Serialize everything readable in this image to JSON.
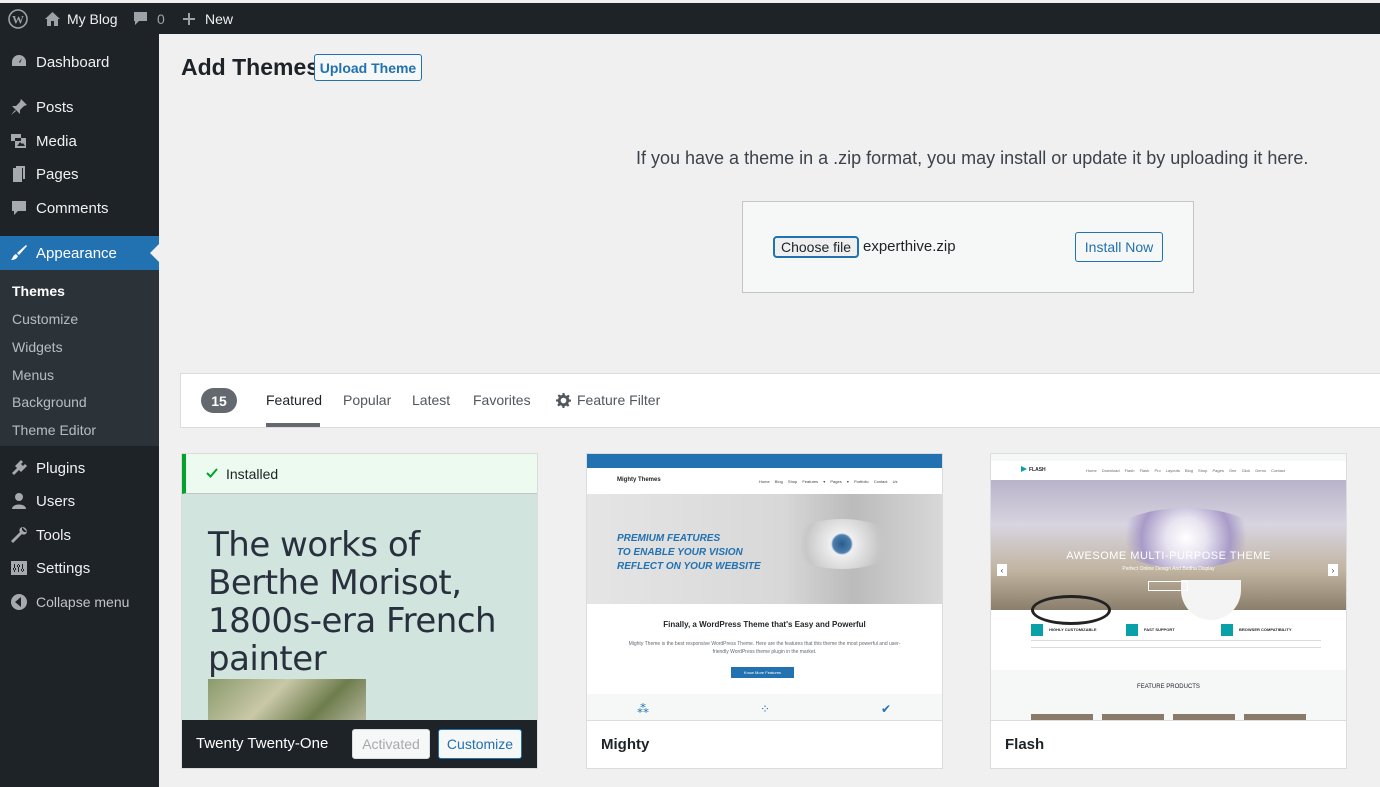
{
  "admin_bar": {
    "site_name": "My Blog",
    "comments_count": "0",
    "new_label": "New"
  },
  "sidebar": {
    "items": [
      {
        "label": "Dashboard",
        "icon": "dashboard-icon"
      },
      {
        "label": "Posts",
        "icon": "pin-icon"
      },
      {
        "label": "Media",
        "icon": "media-icon"
      },
      {
        "label": "Pages",
        "icon": "pages-icon"
      },
      {
        "label": "Comments",
        "icon": "comment-icon"
      },
      {
        "label": "Appearance",
        "icon": "brush-icon",
        "active": true
      },
      {
        "label": "Plugins",
        "icon": "plugin-icon"
      },
      {
        "label": "Users",
        "icon": "user-icon"
      },
      {
        "label": "Tools",
        "icon": "wrench-icon"
      },
      {
        "label": "Settings",
        "icon": "settings-icon"
      },
      {
        "label": "Collapse menu",
        "icon": "collapse-icon"
      }
    ],
    "submenu": [
      "Themes",
      "Customize",
      "Widgets",
      "Menus",
      "Background",
      "Theme Editor"
    ]
  },
  "header": {
    "title": "Add Themes",
    "upload_button": "Upload Theme"
  },
  "upload": {
    "description": "If you have a theme in a .zip format, you may install or update it by uploading it here.",
    "choose_file": "Choose file",
    "file_name": "experthive.zip",
    "install_button": "Install Now"
  },
  "filter": {
    "count": "15",
    "tabs": [
      "Featured",
      "Popular",
      "Latest",
      "Favorites"
    ],
    "feature_filter": "Feature Filter",
    "active_tab": "Featured"
  },
  "themes": [
    {
      "name": "Twenty Twenty-One",
      "installed_label": "Installed",
      "headline": "The works of Berthe Morisot, 1800s-era French painter",
      "activated_label": "Activated",
      "customize_label": "Customize"
    },
    {
      "name": "Mighty",
      "preview": {
        "logo": "Mighty Themes",
        "menu": "Home Blog Shop Features ▾ Pages ▾ Portfolio Contact Us",
        "hero": [
          "PREMIUM FEATURES",
          "TO ENABLE YOUR VISION",
          "REFLECT ON YOUR WEBSITE"
        ],
        "subtitle": "Finally, a WordPress Theme that's Easy and Powerful",
        "paragraph": "Mighty Theme is the best responsive WordPress Theme. Here are the features that this theme the most powerful and user-friendly WordPress theme plugin in the market.",
        "button": "Know More Features"
      }
    },
    {
      "name": "Flash",
      "preview": {
        "logo": "FLASH",
        "menu": "Home Download Flash Flash Pro Layouts Blog Shop Pages One Click Demo Contact",
        "hero_title": "AWESOME MULTI-PURPOSE THEME",
        "hero_sub": "Perfect Online Design And Bettha Display",
        "features": [
          "HIGHLY CUSTOMIZABLE",
          "FAST SUPPORT",
          "BROWSER COMPATIBILITY"
        ],
        "band_title": "FEATURE PRODUCTS"
      }
    }
  ],
  "colors": {
    "accent": "#2271b1",
    "admin_dark": "#1d2327",
    "success": "#00a32a"
  }
}
